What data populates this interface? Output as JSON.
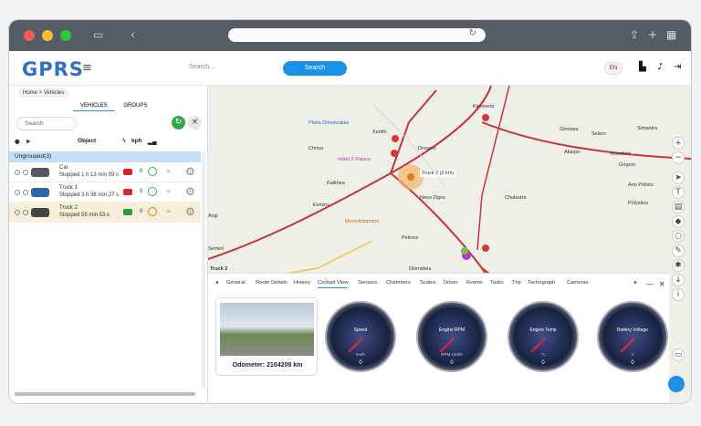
{
  "browser": {
    "reload_icon": "reload-icon"
  },
  "app": {
    "logo": "GPRS",
    "search_placeholder": "Search...",
    "search_label": "Search",
    "language": "EN"
  },
  "left": {
    "breadcrumb": "Home > Vehicles",
    "tabs": [
      "VEHICLES",
      "GROUPS"
    ],
    "search_placeholder": "Search",
    "columns": {
      "object": "Object",
      "speed": "kph"
    },
    "group": "Ungrouped(3)",
    "vehicles": [
      {
        "name": "Car",
        "status": "Stopped 1 h 13 min 59 s",
        "speed": "0"
      },
      {
        "name": "Truck 1",
        "status": "Stopped 3 h 38 min 27 s",
        "speed": "0"
      },
      {
        "name": "Truck 2",
        "status": "Stopped 55 min 53 s",
        "speed": "0"
      }
    ]
  },
  "map": {
    "labels": [
      "Chrisa",
      "Xanthi",
      "Drosero",
      "Kalithea",
      "Evmiro",
      "Neos Zigos",
      "Avgi",
      "Semeli",
      "Petinos",
      "Dlomideia",
      "Chalastra",
      "Akarpo",
      "Genisea",
      "Velochori",
      "Grigoro",
      "Ano Polisto",
      "Polysitos",
      "Simantra",
      "Selero",
      "Kimmeria",
      "Platia Dimokratias",
      "Mezedokamino",
      "Truck 2",
      "Hotel Z Palace",
      "Truck 2 (0 km)"
    ]
  },
  "cockpit": {
    "tabs": [
      "General",
      "Route Details",
      "History",
      "Cockpit View",
      "Sensors",
      "Chambers",
      "Scales",
      "Driver",
      "Events",
      "Tasks",
      "Trip",
      "Tachograph",
      "Cameras"
    ],
    "odometer": "Odometer: 2104208 km",
    "gauges": [
      {
        "label": "Speed",
        "unit": "km/h",
        "value": "0"
      },
      {
        "label": "Engine RPM",
        "unit": "RPM x1000",
        "value": "0"
      },
      {
        "label": "Engine Temp",
        "unit": "°C",
        "value": "0"
      },
      {
        "label": "Battery Voltage",
        "unit": "V",
        "value": "0"
      }
    ]
  }
}
